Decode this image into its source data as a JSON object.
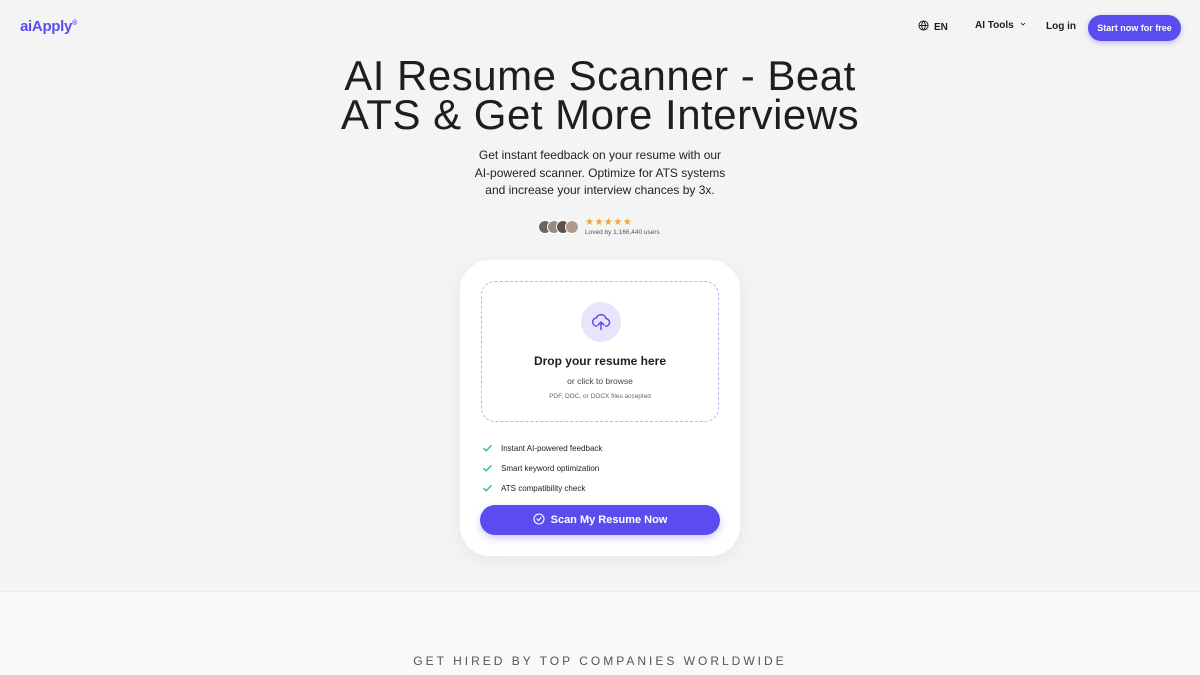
{
  "header": {
    "logo": "aiApply",
    "logo_mark": "®",
    "language": "EN",
    "ai_tools": "AI Tools",
    "login": "Log in",
    "cta": "Start now for free"
  },
  "hero": {
    "title": "AI Resume Scanner - Beat ATS & Get More Interviews",
    "subtitle": "Get instant feedback on your resume with our AI-powered scanner. Optimize for ATS systems and increase your interview chances by 3x.",
    "stars": "★★★★★",
    "loved_by": "Loved by 1,166,440 users"
  },
  "upload": {
    "title": "Drop your resume here",
    "browse": "or click to browse",
    "accepted": "PDF, DOC, or DOCX files accepted"
  },
  "features": [
    "Instant AI-powered feedback",
    "Smart keyword optimization",
    "ATS compatibility check"
  ],
  "scan_button": "Scan My Resume Now",
  "hired_banner": "GET HIRED BY TOP COMPANIES WORLDWIDE",
  "colors": {
    "accent": "#5b4cf0",
    "check": "#2fbf71",
    "stars": "#f5a623"
  }
}
